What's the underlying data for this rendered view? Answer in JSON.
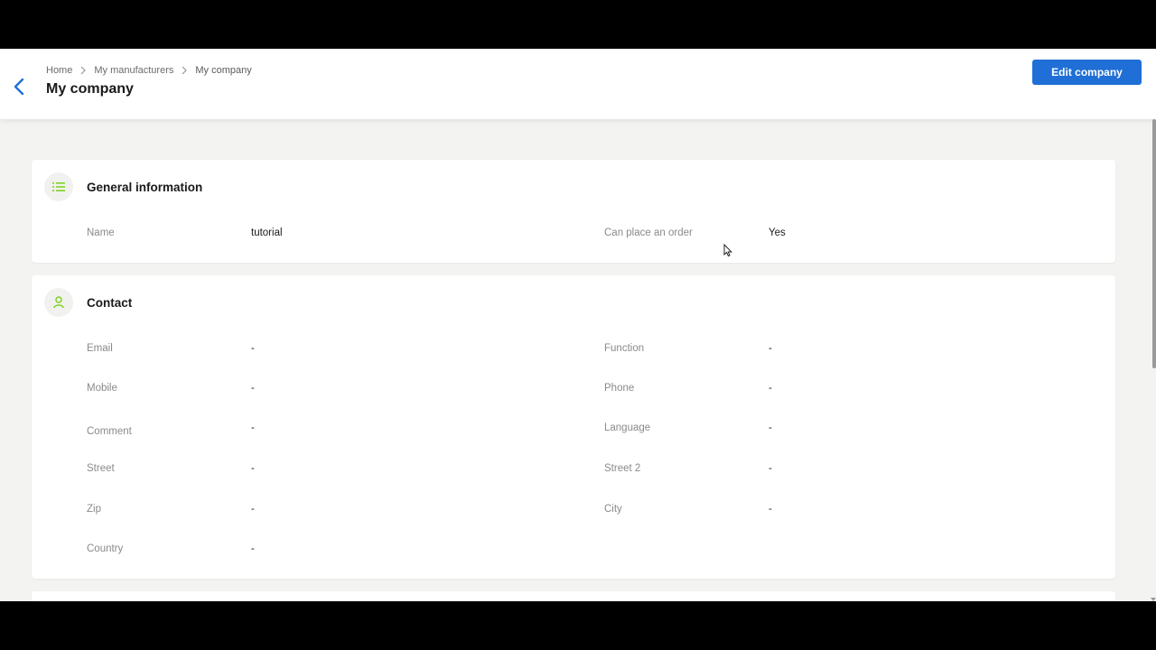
{
  "header": {
    "breadcrumb": [
      "Home",
      "My manufacturers",
      "My company"
    ],
    "title": "My company",
    "edit_button": "Edit company"
  },
  "general": {
    "title": "General information",
    "icon": "list-icon",
    "fields": [
      {
        "label": "Name",
        "value": "tutorial"
      },
      {
        "label": "Can place an order",
        "value": "Yes"
      }
    ]
  },
  "contact": {
    "title": "Contact",
    "icon": "person-icon",
    "fields": [
      {
        "label": "Email",
        "value": "-"
      },
      {
        "label": "Function",
        "value": "-"
      },
      {
        "label": "Mobile",
        "value": "-"
      },
      {
        "label": "Phone",
        "value": "-"
      },
      {
        "label": "Comment",
        "value": "-"
      },
      {
        "label": "Language",
        "value": "-"
      },
      {
        "label": "Street",
        "value": "-"
      },
      {
        "label": "Street 2",
        "value": "-"
      },
      {
        "label": "Zip",
        "value": "-"
      },
      {
        "label": "City",
        "value": "-"
      },
      {
        "label": "Country",
        "value": "-"
      }
    ]
  },
  "colors": {
    "accent": "#1f6fd6",
    "icon_green": "#7ed321",
    "background": "#f3f3f1"
  }
}
